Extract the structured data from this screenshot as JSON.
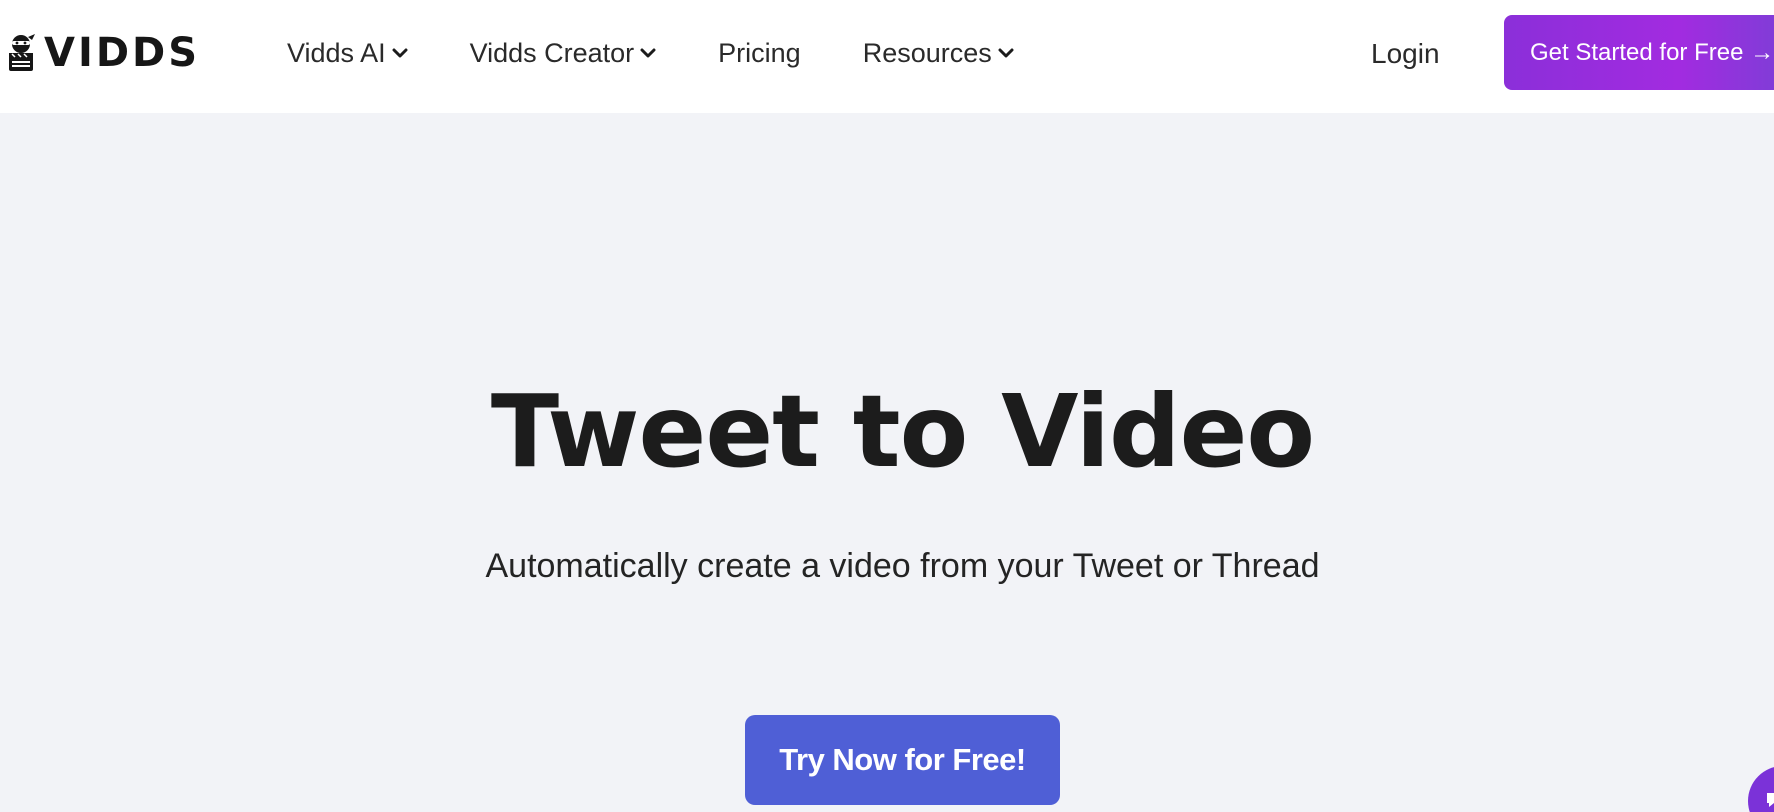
{
  "brand": {
    "logo_text": "VIDDS",
    "logo_icon": "ninja-clapperboard-icon"
  },
  "nav": {
    "items": [
      {
        "label": "Vidds AI",
        "has_dropdown": true
      },
      {
        "label": "Vidds Creator",
        "has_dropdown": true
      },
      {
        "label": "Pricing",
        "has_dropdown": false
      },
      {
        "label": "Resources",
        "has_dropdown": true
      }
    ],
    "dropdown_icon": "chevron-down-icon"
  },
  "header": {
    "login_label": "Login",
    "cta_label": "Get Started for Free →"
  },
  "hero": {
    "title": "Tweet to Video",
    "subtitle": "Automatically create a video from your Tweet or Thread",
    "button_label": "Try Now for Free!"
  },
  "chat": {
    "icon": "chat-icon"
  },
  "colors": {
    "background": "#f2f3f7",
    "header_bg": "#ffffff",
    "cta_gradient_start": "#8b2fd9",
    "cta_gradient_end": "#7b3fd6",
    "primary_button": "#4f5fd6",
    "chat_bubble": "#7b32d8",
    "text_dark": "#1c1c1c"
  }
}
